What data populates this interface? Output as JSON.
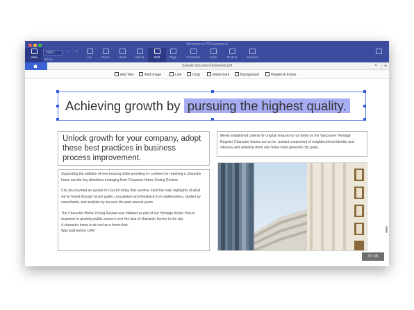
{
  "window": {
    "title": "Welcome to PDFelement 6"
  },
  "toolbar": {
    "view_label": "View",
    "zoom_value": "161%",
    "zoom_label": "Zoom",
    "zoom_out": "−",
    "zoom_in": "+",
    "up_label": "Up",
    "down_label": "Down",
    "hand_label": "Hand",
    "select_label": "Select",
    "edit_label": "Edit",
    "page_label": "Page",
    "comment_label": "Comment",
    "form_label": "Form",
    "protect_label": "Protect",
    "convert_label": "Convert"
  },
  "tabs": {
    "document_title": "Sample Document Extended.pdf",
    "close": "×",
    "add": "+"
  },
  "edit_tools": {
    "add_text": "Add Text",
    "add_image": "Add Image",
    "link": "Link",
    "crop": "Crop",
    "watermark": "Watermark",
    "background": "Background",
    "header_footer": "Header & Footer"
  },
  "document": {
    "heading_before": "Achieving growth by ",
    "heading_selected": "pursuing the highest quality.",
    "subheading": "Unlock growth for your company, adopt these best practices in business process improvement.",
    "side_text": "Meets established criteria for original features is not listed on the Vancouver Heritage Register Character homes are an im- portant component of neighbourhood identity and vibrancy and retaining them also helps meet greenest city goals.",
    "body_p1": "Supporting the addition of new housing while providing in- centives for retaining a character home are the key directions emerging from Character Home Zoning Review.",
    "body_p2": "City sta  provided an update to Council today that summa- rized the main highlights of what we’ve heard through recent public consultation and feedback from stakeholders, studies by consultants, and analysis by sta  over the past several years.",
    "body_p3": "The Character Home Zoning Review was initiated as part of our Heritage Action Plan in response to growing public concern over the loss of character homes in the city.",
    "body_p4": "A character home is de ned as a home that:",
    "body_p5": "Was built before 1940"
  },
  "status": {
    "page_counter": "37 / 45"
  },
  "colors": {
    "titlebar": "#3b4c9e",
    "home_tab": "#3b63d8",
    "selection": "#a7adf2",
    "handles": "#2f5be0"
  }
}
